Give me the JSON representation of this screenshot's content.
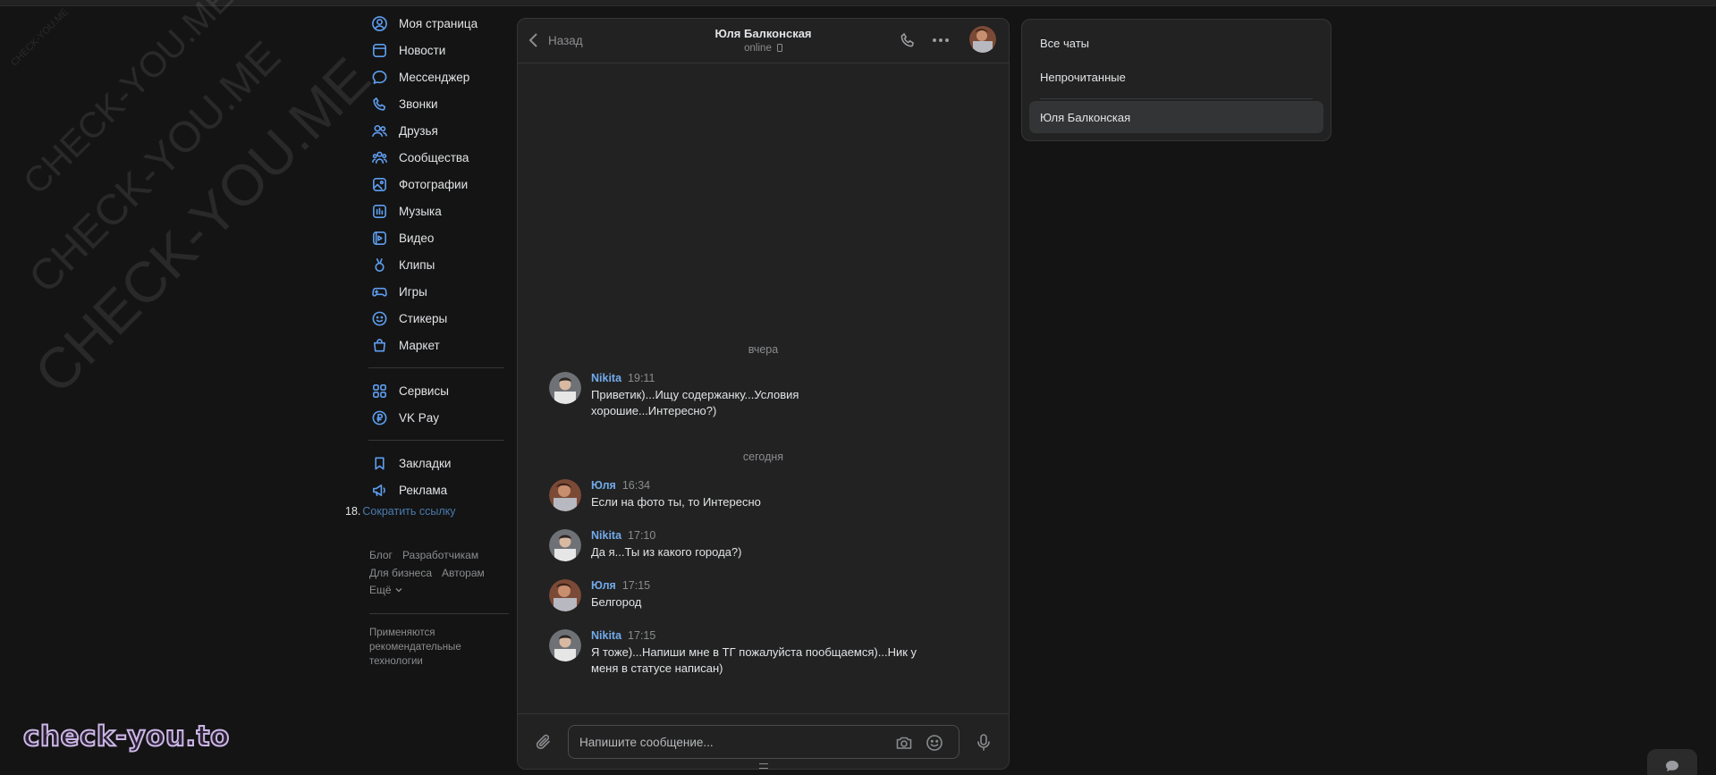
{
  "watermark": {
    "text_small": "CHECK-YOU.ME",
    "text_medium": "CHECK-YOU.ME",
    "text_large": "CHECK-YOU.ME",
    "text_xlarge": "CHECK-YOU.ME",
    "brand": "check-you.to"
  },
  "nav": {
    "items": [
      {
        "label": "Моя страница",
        "icon": "user-circle-icon"
      },
      {
        "label": "Новости",
        "icon": "newspaper-icon"
      },
      {
        "label": "Мессенджер",
        "icon": "message-icon"
      },
      {
        "label": "Звонки",
        "icon": "phone-icon"
      },
      {
        "label": "Друзья",
        "icon": "friends-icon"
      },
      {
        "label": "Сообщества",
        "icon": "communities-icon"
      },
      {
        "label": "Фотографии",
        "icon": "photo-icon"
      },
      {
        "label": "Музыка",
        "icon": "music-icon"
      },
      {
        "label": "Видео",
        "icon": "video-icon"
      },
      {
        "label": "Клипы",
        "icon": "clips-icon"
      },
      {
        "label": "Игры",
        "icon": "gamepad-icon"
      },
      {
        "label": "Стикеры",
        "icon": "sticker-icon"
      },
      {
        "label": "Маркет",
        "icon": "bag-icon"
      }
    ],
    "services": [
      {
        "label": "Сервисы",
        "icon": "grid-icon"
      },
      {
        "label": "VK Pay",
        "icon": "vkpay-icon"
      }
    ],
    "extra": [
      {
        "label": "Закладки",
        "icon": "bookmark-icon"
      },
      {
        "label": "Реклама",
        "icon": "megaphone-icon"
      }
    ],
    "short_link_number": "18.",
    "short_link_label": "Сократить ссылку",
    "footer": {
      "blog": "Блог",
      "developers": "Разработчикам",
      "business": "Для бизнеса",
      "authors": "Авторам",
      "more": "Ещё"
    },
    "recommend_note": "Применяются рекомендательные технологии"
  },
  "chat": {
    "back_label": "Назад",
    "peer_name": "Юля Балконская",
    "peer_status": "online",
    "composer_placeholder": "Напишите сообщение...",
    "date_separators": [
      "вчера",
      "сегодня"
    ],
    "messages": [
      {
        "author": "Nikita",
        "time": "19:11",
        "text": "Приветик)...Ищу содержанку...Условия хорошие...Интересно?)"
      },
      {
        "author": "Юля",
        "time": "16:34",
        "text": "Если на фото ты, то Интересно"
      },
      {
        "author": "Nikita",
        "time": "17:10",
        "text": "Да я...Ты из какого города?)"
      },
      {
        "author": "Юля",
        "time": "17:15",
        "text": "Белгород"
      },
      {
        "author": "Nikita",
        "time": "17:15",
        "text": "Я тоже)...Напиши мне в ТГ пожалуйста пообщаемся)...Ник у меня в статусе написан)"
      }
    ]
  },
  "folders": {
    "all": "Все чаты",
    "unread": "Непрочитанные",
    "current": "Юля Балконская"
  },
  "colors": {
    "accent": "#71aaeb",
    "icon_blue": "#5e9ef0",
    "background": "#141414",
    "panel": "#222222"
  }
}
